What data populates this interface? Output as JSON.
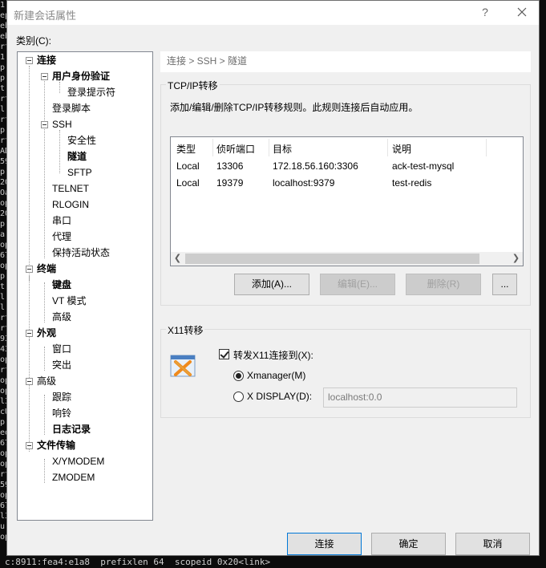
{
  "window": {
    "title": "新建会话属性",
    "help_glyph": "?",
    "close_glyph": "✕"
  },
  "category_label": "类别(C):",
  "tree": [
    {
      "label": "连接",
      "bold": true
    },
    {
      "label": "用户身份验证",
      "bold": true
    },
    {
      "label": "登录提示符",
      "bold": false
    },
    {
      "label": "登录脚本",
      "bold": false
    },
    {
      "label": "SSH",
      "bold": false
    },
    {
      "label": "安全性",
      "bold": false
    },
    {
      "label": "隧道",
      "bold": true
    },
    {
      "label": "SFTP",
      "bold": false
    },
    {
      "label": "TELNET",
      "bold": false
    },
    {
      "label": "RLOGIN",
      "bold": false
    },
    {
      "label": "串口",
      "bold": false
    },
    {
      "label": "代理",
      "bold": false
    },
    {
      "label": "保持活动状态",
      "bold": false
    },
    {
      "label": "终端",
      "bold": true
    },
    {
      "label": "键盘",
      "bold": true
    },
    {
      "label": "VT 模式",
      "bold": false
    },
    {
      "label": "高级",
      "bold": false
    },
    {
      "label": "外观",
      "bold": true
    },
    {
      "label": "窗口",
      "bold": false
    },
    {
      "label": "突出",
      "bold": false
    },
    {
      "label": "高级",
      "bold": false
    },
    {
      "label": "跟踪",
      "bold": false
    },
    {
      "label": "响铃",
      "bold": false
    },
    {
      "label": "日志记录",
      "bold": true
    },
    {
      "label": "文件传输",
      "bold": true
    },
    {
      "label": "X/YMODEM",
      "bold": false
    },
    {
      "label": "ZMODEM",
      "bold": false
    }
  ],
  "breadcrumb": "连接 > SSH > 隧道",
  "tcpip": {
    "group_title": "TCP/IP转移",
    "description": "添加/编辑/删除TCP/IP转移规则。此规则连接后自动应用。",
    "columns": [
      "类型",
      "侦听端口",
      "目标",
      "说明"
    ],
    "rows": [
      [
        "Local",
        "13306",
        "172.18.56.160:3306",
        "ack-test-mysql"
      ],
      [
        "Local",
        "19379",
        "localhost:9379",
        "test-redis"
      ]
    ],
    "buttons": {
      "add": "添加(A)...",
      "edit": "编辑(E)...",
      "delete": "删除(R)",
      "more": "..."
    }
  },
  "x11": {
    "group_title": "X11转移",
    "forward_label": "转发X11连接到(X):",
    "forward_checked": true,
    "xmanager_label": "Xmanager(M)",
    "xmanager_selected": true,
    "xdisplay_label": "X DISPLAY(D):",
    "xdisplay_value": "localhost:0.0"
  },
  "footer": {
    "connect": "连接",
    "ok": "确定",
    "cancel": "取消"
  },
  "terminal_bottom_line": "c:8911:fea4:e1a8  prefixlen 64  scopeid 0x20<link>",
  "terminal_left": [
    "1",
    "ep",
    "eb",
    "eb",
    "rt",
    "1",
    "p",
    "p",
    "t",
    "rt",
    "l",
    "rt",
    "p",
    "rt",
    "AD",
    "59",
    "p",
    "20",
    "Oa",
    "op",
    "20",
    "p",
    "a",
    "op",
    "67",
    "op",
    "p",
    "t,",
    "l",
    "l",
    "rt",
    "rt",
    "93",
    "43",
    "op",
    "rt",
    "op",
    "op",
    "l3",
    "cU",
    "p",
    "eo",
    "67",
    "op",
    "op",
    "rt",
    "59",
    "op",
    "67",
    "l3",
    "u",
    "op"
  ],
  "colors": {
    "dialog_bg": "#f0f0f0",
    "terminal_bg": "#0c0c0c",
    "accent": "#0078d7"
  }
}
